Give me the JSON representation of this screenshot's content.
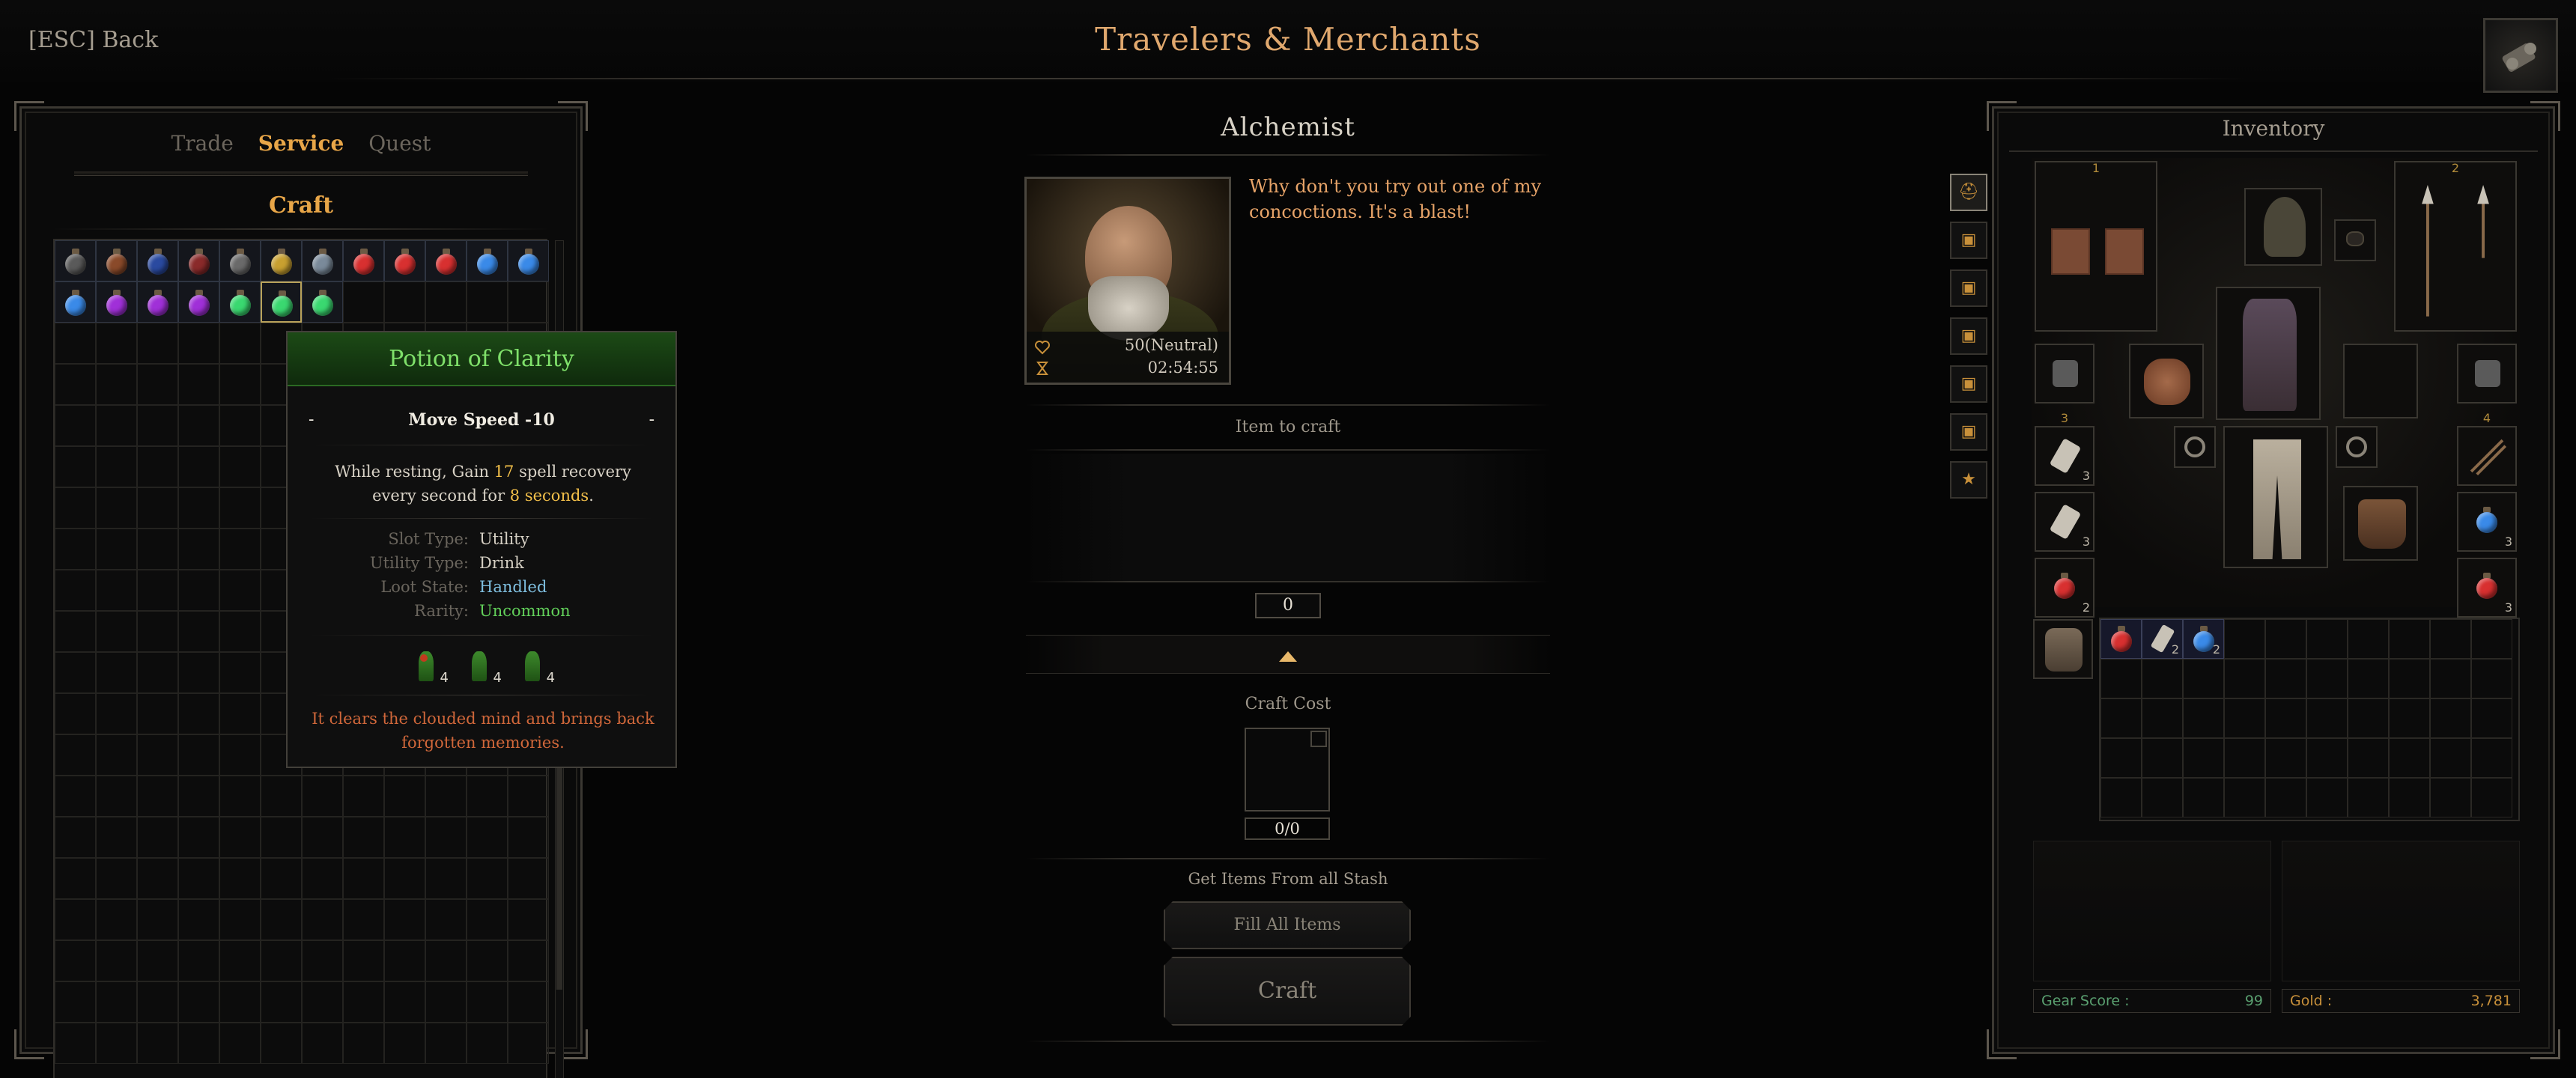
{
  "header": {
    "back_label": "[ESC] Back",
    "title": "Travelers & Merchants",
    "map_icon": "scroll-map-icon"
  },
  "left_panel": {
    "tabs": [
      {
        "label": "Trade",
        "active": false
      },
      {
        "label": "Service",
        "active": true
      },
      {
        "label": "Quest",
        "active": false
      }
    ],
    "section_title": "Craft",
    "recipes": [
      {
        "name": "helmet-potion",
        "color": "#5a5a5a"
      },
      {
        "name": "rust-potion",
        "color": "#8a4a2a"
      },
      {
        "name": "blue-dark-potion",
        "color": "#2a4aa0"
      },
      {
        "name": "red-dark-potion",
        "color": "#8a2a2a"
      },
      {
        "name": "grey-potion",
        "color": "#6a6a6a"
      },
      {
        "name": "gold-potion",
        "color": "#c8a030"
      },
      {
        "name": "steel-potion",
        "color": "#7a8a9a"
      },
      {
        "name": "red-potion",
        "color": "#d83030"
      },
      {
        "name": "red-potion",
        "color": "#d83030"
      },
      {
        "name": "red-potion",
        "color": "#d83030"
      },
      {
        "name": "blue-potion",
        "color": "#3a8ae8"
      },
      {
        "name": "blue-potion",
        "color": "#3a8ae8"
      },
      {
        "name": "blue-potion",
        "color": "#3a8ae8"
      },
      {
        "name": "purple-potion",
        "color": "#a030d8"
      },
      {
        "name": "purple-potion",
        "color": "#a030d8"
      },
      {
        "name": "purple-potion",
        "color": "#a030d8"
      },
      {
        "name": "green-potion",
        "color": "#3ad870"
      },
      {
        "name": "green-potion",
        "color": "#3ad870",
        "selected": true
      },
      {
        "name": "green-potion",
        "color": "#3ad870"
      }
    ]
  },
  "tooltip": {
    "title": "Potion of Clarity",
    "stat": "Move Speed -10",
    "dash": "-",
    "desc_pre": "While resting, Gain ",
    "desc_num": "17",
    "desc_mid": " spell recovery every second for ",
    "desc_dur": "8 seconds",
    "desc_end": ".",
    "props": [
      {
        "label": "Slot Type:",
        "value": "Utility"
      },
      {
        "label": "Utility Type:",
        "value": "Drink"
      },
      {
        "label": "Loot State:",
        "value": "Handled"
      },
      {
        "label": "Rarity:",
        "value": "Uncommon"
      }
    ],
    "ingredients": [
      {
        "qty": "4"
      },
      {
        "qty": "4"
      },
      {
        "qty": "4"
      }
    ],
    "lore": "It clears the clouded mind and brings back forgotten memories."
  },
  "merchant": {
    "name": "Alchemist",
    "affinity": "50(Neutral)",
    "timer": "02:54:55",
    "quote": "Why don't you try out one of my concoctions. It's a blast!"
  },
  "craft": {
    "item_heading": "Item to craft",
    "quantity": "0",
    "cost_heading": "Craft Cost",
    "cost_count": "0/0",
    "stash_label": "Get Items From all Stash",
    "fill_label": "Fill All Items",
    "craft_label": "Craft"
  },
  "inventory": {
    "title": "Inventory",
    "weapon_slot_1": "1",
    "weapon_slot_2": "2",
    "utility_left_num": "3",
    "utility_right_num": "4",
    "left_utility_qty": [
      "3",
      "3",
      "2"
    ],
    "right_utility_qty": [
      "",
      "3",
      "3"
    ],
    "bag_items": [
      {
        "name": "red-potion",
        "qty": ""
      },
      {
        "name": "bandage",
        "qty": "2"
      },
      {
        "name": "blue-potion",
        "qty": "2"
      }
    ],
    "gear_score_label": "Gear Score :",
    "gear_score": "99",
    "gold_label": "Gold :",
    "gold": "3,781"
  }
}
